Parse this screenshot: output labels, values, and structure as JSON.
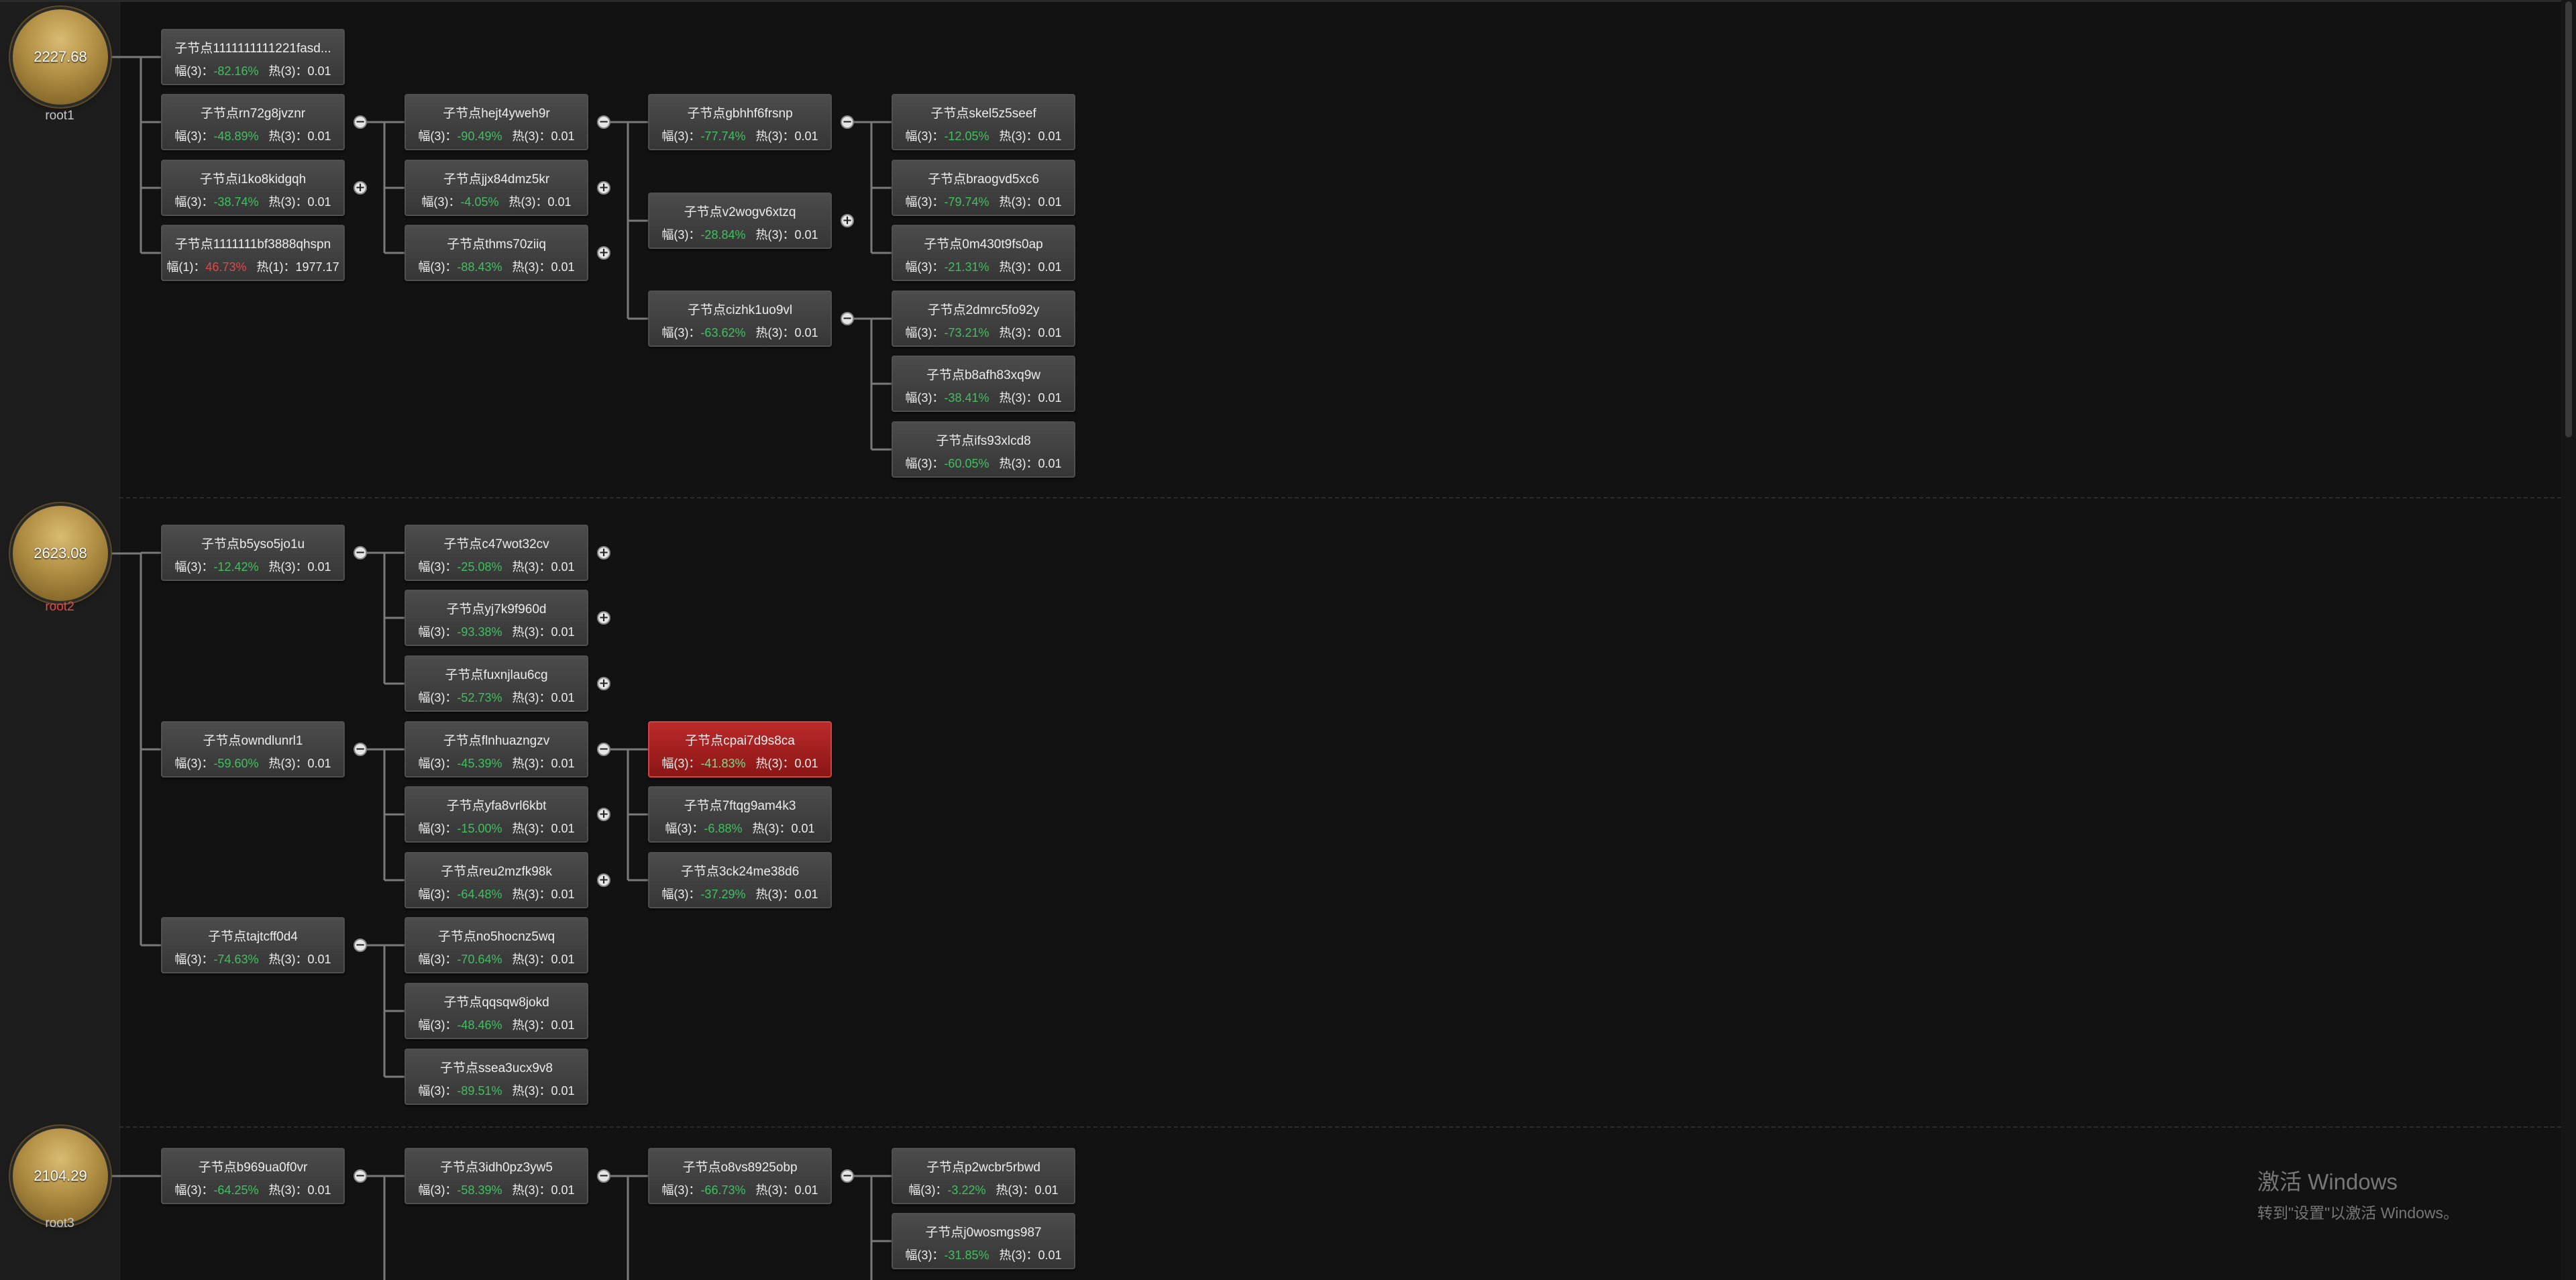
{
  "roots": [
    {
      "value": "2227.68",
      "label": "root1",
      "label_color": "normal"
    },
    {
      "value": "2623.08",
      "label": "root2",
      "label_color": "red"
    },
    {
      "value": "2104.29",
      "label": "root3",
      "label_color": "normal"
    }
  ],
  "stat_labels": {
    "fu": "幅",
    "re": "热"
  },
  "nodes": [
    {
      "id": "n1",
      "title": "子节点1111111111221fasd...",
      "fu_n": "3",
      "fu_v": "-82.16%",
      "re_n": "3",
      "re_v": "0.01",
      "dir": "down"
    },
    {
      "id": "n2",
      "title": "子节点rn72g8jvznr",
      "fu_n": "3",
      "fu_v": "-48.89%",
      "re_n": "3",
      "re_v": "0.01",
      "dir": "down",
      "toggle": "−"
    },
    {
      "id": "n3",
      "title": "子节点i1ko8kidgqh",
      "fu_n": "3",
      "fu_v": "-38.74%",
      "re_n": "3",
      "re_v": "0.01",
      "dir": "down",
      "toggle": "+"
    },
    {
      "id": "n4",
      "title": "子节点1111111bf3888qhspn",
      "fu_n": "1",
      "fu_v": "46.73%",
      "re_n": "1",
      "re_v": "1977.17",
      "dir": "up"
    },
    {
      "id": "n5",
      "title": "子节点hejt4yweh9r",
      "fu_n": "3",
      "fu_v": "-90.49%",
      "re_n": "3",
      "re_v": "0.01",
      "dir": "down",
      "toggle": "−"
    },
    {
      "id": "n6",
      "title": "子节点jjx84dmz5kr",
      "fu_n": "3",
      "fu_v": "-4.05%",
      "re_n": "3",
      "re_v": "0.01",
      "dir": "down",
      "toggle": "+"
    },
    {
      "id": "n7",
      "title": "子节点thms70ziiq",
      "fu_n": "3",
      "fu_v": "-88.43%",
      "re_n": "3",
      "re_v": "0.01",
      "dir": "down",
      "toggle": "+"
    },
    {
      "id": "n8",
      "title": "子节点gbhhf6frsnp",
      "fu_n": "3",
      "fu_v": "-77.74%",
      "re_n": "3",
      "re_v": "0.01",
      "dir": "down",
      "toggle": "−"
    },
    {
      "id": "n9",
      "title": "子节点v2wogv6xtzq",
      "fu_n": "3",
      "fu_v": "-28.84%",
      "re_n": "3",
      "re_v": "0.01",
      "dir": "down",
      "toggle": "+"
    },
    {
      "id": "n10",
      "title": "子节点cizhk1uo9vl",
      "fu_n": "3",
      "fu_v": "-63.62%",
      "re_n": "3",
      "re_v": "0.01",
      "dir": "down",
      "toggle": "−"
    },
    {
      "id": "n11",
      "title": "子节点skel5z5seef",
      "fu_n": "3",
      "fu_v": "-12.05%",
      "re_n": "3",
      "re_v": "0.01",
      "dir": "down"
    },
    {
      "id": "n12",
      "title": "子节点braogvd5xc6",
      "fu_n": "3",
      "fu_v": "-79.74%",
      "re_n": "3",
      "re_v": "0.01",
      "dir": "down"
    },
    {
      "id": "n13",
      "title": "子节点0m430t9fs0ap",
      "fu_n": "3",
      "fu_v": "-21.31%",
      "re_n": "3",
      "re_v": "0.01",
      "dir": "down"
    },
    {
      "id": "n14",
      "title": "子节点2dmrc5fo92y",
      "fu_n": "3",
      "fu_v": "-73.21%",
      "re_n": "3",
      "re_v": "0.01",
      "dir": "down"
    },
    {
      "id": "n15",
      "title": "子节点b8afh83xq9w",
      "fu_n": "3",
      "fu_v": "-38.41%",
      "re_n": "3",
      "re_v": "0.01",
      "dir": "down"
    },
    {
      "id": "n16",
      "title": "子节点ifs93xlcd8",
      "fu_n": "3",
      "fu_v": "-60.05%",
      "re_n": "3",
      "re_v": "0.01",
      "dir": "down"
    },
    {
      "id": "n17",
      "title": "子节点b5yso5jo1u",
      "fu_n": "3",
      "fu_v": "-12.42%",
      "re_n": "3",
      "re_v": "0.01",
      "dir": "down",
      "toggle": "−"
    },
    {
      "id": "n18",
      "title": "子节点owndlunrl1",
      "fu_n": "3",
      "fu_v": "-59.60%",
      "re_n": "3",
      "re_v": "0.01",
      "dir": "down",
      "toggle": "−"
    },
    {
      "id": "n19",
      "title": "子节点tajtcff0d4",
      "fu_n": "3",
      "fu_v": "-74.63%",
      "re_n": "3",
      "re_v": "0.01",
      "dir": "down",
      "toggle": "−"
    },
    {
      "id": "n20",
      "title": "子节点c47wot32cv",
      "fu_n": "3",
      "fu_v": "-25.08%",
      "re_n": "3",
      "re_v": "0.01",
      "dir": "down",
      "toggle": "+"
    },
    {
      "id": "n21",
      "title": "子节点yj7k9f960d",
      "fu_n": "3",
      "fu_v": "-93.38%",
      "re_n": "3",
      "re_v": "0.01",
      "dir": "down",
      "toggle": "+"
    },
    {
      "id": "n22",
      "title": "子节点fuxnjlau6cg",
      "fu_n": "3",
      "fu_v": "-52.73%",
      "re_n": "3",
      "re_v": "0.01",
      "dir": "down",
      "toggle": "+"
    },
    {
      "id": "n23",
      "title": "子节点flnhuazngzv",
      "fu_n": "3",
      "fu_v": "-45.39%",
      "re_n": "3",
      "re_v": "0.01",
      "dir": "down",
      "toggle": "−"
    },
    {
      "id": "n24",
      "title": "子节点yfa8vrl6kbt",
      "fu_n": "3",
      "fu_v": "-15.00%",
      "re_n": "3",
      "re_v": "0.01",
      "dir": "down",
      "toggle": "+"
    },
    {
      "id": "n25",
      "title": "子节点reu2mzfk98k",
      "fu_n": "3",
      "fu_v": "-64.48%",
      "re_n": "3",
      "re_v": "0.01",
      "dir": "down",
      "toggle": "+"
    },
    {
      "id": "n26",
      "title": "子节点no5hocnz5wq",
      "fu_n": "3",
      "fu_v": "-70.64%",
      "re_n": "3",
      "re_v": "0.01",
      "dir": "down"
    },
    {
      "id": "n27",
      "title": "子节点qqsqw8jokd",
      "fu_n": "3",
      "fu_v": "-48.46%",
      "re_n": "3",
      "re_v": "0.01",
      "dir": "down"
    },
    {
      "id": "n28",
      "title": "子节点ssea3ucx9v8",
      "fu_n": "3",
      "fu_v": "-89.51%",
      "re_n": "3",
      "re_v": "0.01",
      "dir": "down"
    },
    {
      "id": "n29",
      "title": "子节点cpai7d9s8ca",
      "fu_n": "3",
      "fu_v": "-41.83%",
      "re_n": "3",
      "re_v": "0.01",
      "dir": "down",
      "highlight": true
    },
    {
      "id": "n30",
      "title": "子节点7ftqg9am4k3",
      "fu_n": "3",
      "fu_v": "-6.88%",
      "re_n": "3",
      "re_v": "0.01",
      "dir": "down"
    },
    {
      "id": "n31",
      "title": "子节点3ck24me38d6",
      "fu_n": "3",
      "fu_v": "-37.29%",
      "re_n": "3",
      "re_v": "0.01",
      "dir": "down"
    },
    {
      "id": "n32",
      "title": "子节点b969ua0f0vr",
      "fu_n": "3",
      "fu_v": "-64.25%",
      "re_n": "3",
      "re_v": "0.01",
      "dir": "down",
      "toggle": "−"
    },
    {
      "id": "n33",
      "title": "子节点3idh0pz3yw5",
      "fu_n": "3",
      "fu_v": "-58.39%",
      "re_n": "3",
      "re_v": "0.01",
      "dir": "down",
      "toggle": "−"
    },
    {
      "id": "n34",
      "title": "子节点o8vs8925obp",
      "fu_n": "3",
      "fu_v": "-66.73%",
      "re_n": "3",
      "re_v": "0.01",
      "dir": "down",
      "toggle": "−"
    },
    {
      "id": "n35",
      "title": "子节点p2wcbr5rbwd",
      "fu_n": "3",
      "fu_v": "-3.22%",
      "re_n": "3",
      "re_v": "0.01",
      "dir": "down"
    },
    {
      "id": "n36",
      "title": "子节点j0wosmgs987",
      "fu_n": "3",
      "fu_v": "-31.85%",
      "re_n": "3",
      "re_v": "0.01",
      "dir": "down"
    }
  ],
  "watermark": {
    "line1": "激活 Windows",
    "line2": "转到\"设置\"以激活 Windows。"
  },
  "colors": {
    "background": "#121212",
    "positive": "#e24848",
    "negative": "#3fc15e",
    "highlight": "#a82020",
    "root": "#b39146"
  }
}
